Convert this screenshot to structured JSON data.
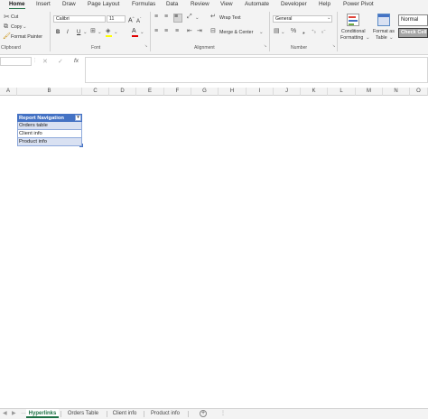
{
  "menu": {
    "tabs": [
      "Home",
      "Insert",
      "Draw",
      "Page Layout",
      "Formulas",
      "Data",
      "Review",
      "View",
      "Automate",
      "Developer",
      "Help",
      "Power Pivot"
    ],
    "active": "Home"
  },
  "clipboard": {
    "paste_label": "Paste",
    "cut": "Cut",
    "copy": "Copy",
    "format_painter": "Format Painter",
    "group_label": "Clipboard"
  },
  "font": {
    "name": "Calibri",
    "size": "11",
    "group_label": "Font"
  },
  "alignment": {
    "wrap_text": "Wrap Text",
    "merge_center": "Merge & Center",
    "group_label": "Alignment"
  },
  "number": {
    "format": "General",
    "group_label": "Number"
  },
  "styles": {
    "conditional_1": "Conditional",
    "conditional_2": "Formatting",
    "format_table_1": "Format as",
    "format_table_2": "Table",
    "normal": "Normal",
    "check_cell": "Check Cell"
  },
  "formula_bar": {
    "name_box": "",
    "fx": "fx",
    "content": ""
  },
  "columns": [
    "A",
    "B",
    "C",
    "D",
    "E",
    "F",
    "G",
    "H",
    "I",
    "J",
    "K",
    "L",
    "M",
    "N",
    "O"
  ],
  "table": {
    "header": "Report Navigation",
    "rows": [
      "Orders table",
      "Client info",
      "Product info"
    ]
  },
  "sheets": {
    "tabs": [
      "Hyperlinks",
      "Orders Table",
      "Client info",
      "Product info"
    ],
    "active": "Hyperlinks"
  },
  "colors": {
    "accent_green": "#1e7145",
    "table_header": "#4472c4",
    "table_band": "#d9e1f2"
  }
}
